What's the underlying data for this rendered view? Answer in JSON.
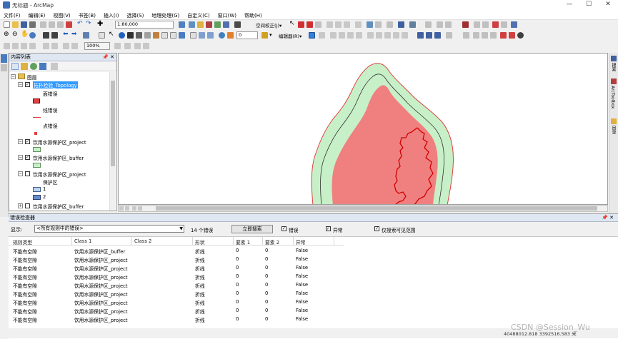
{
  "window": {
    "title": "无标题 - ArcMap",
    "min": "—",
    "max": "☐",
    "close": "✕"
  },
  "menu": [
    "文件(F)",
    "编辑(E)",
    "视图(V)",
    "书签(B)",
    "插入(I)",
    "选择(S)",
    "地理处理(G)",
    "自定义(C)",
    "窗口(W)",
    "帮助(H)"
  ],
  "toolbar": {
    "scale": "1:80,000",
    "spatial_adjust": "空间校正(J)▾",
    "editor": "编辑器(R)▾",
    "zoom_combo": "0",
    "percent": "100%"
  },
  "toc": {
    "title": "内容列表",
    "pin": "📌 ✕",
    "root": "图层",
    "items": [
      {
        "label": "拓扑检验_Topology",
        "checked": true,
        "selected": true
      },
      {
        "label": "面错误"
      },
      {
        "label": "线错误"
      },
      {
        "label": "点错误"
      },
      {
        "label": "饮用水源保护区_project",
        "checked": true
      },
      {
        "label": "饮用水源保护区_buffer",
        "checked": true
      },
      {
        "label": "饮用水源保护区_project",
        "checked": false
      },
      {
        "label": "保护区"
      },
      {
        "label": "1"
      },
      {
        "label": "2"
      },
      {
        "label": "饮用水源保护区_buffer",
        "checked": false
      }
    ]
  },
  "right_tabs": [
    "搜索",
    "ArcToolbox",
    "目录"
  ],
  "error_inspector": {
    "title": "错误检查器",
    "show_label": "显示:",
    "show_value": "<所有规则中的错误>",
    "count": "14 个错误",
    "search_btn": "立即搜索",
    "cb_errors": "错误",
    "cb_exceptions": "异常",
    "cb_visible": "仅搜索可见范围",
    "columns": [
      "规则类型",
      "Class 1",
      "Class 2",
      "形状",
      "要素 1",
      "要素 2",
      "异常"
    ],
    "rows": [
      [
        "不能有空隙",
        "饮用水源保护区_buffer",
        "",
        "折线",
        "0",
        "0",
        "False"
      ],
      [
        "不能有空隙",
        "饮用水源保护区_project",
        "",
        "折线",
        "0",
        "0",
        "False"
      ],
      [
        "不能有空隙",
        "饮用水源保护区_project",
        "",
        "折线",
        "0",
        "0",
        "False"
      ],
      [
        "不能有空隙",
        "饮用水源保护区_project",
        "",
        "折线",
        "0",
        "0",
        "False"
      ],
      [
        "不能有空隙",
        "饮用水源保护区_project",
        "",
        "折线",
        "0",
        "0",
        "False"
      ],
      [
        "不能有空隙",
        "饮用水源保护区_project",
        "",
        "折线",
        "0",
        "0",
        "False"
      ],
      [
        "不能有空隙",
        "饮用水源保护区_project",
        "",
        "折线",
        "0",
        "0",
        "False"
      ],
      [
        "不能有空隙",
        "饮用水源保护区_project",
        "",
        "折线",
        "0",
        "0",
        "False"
      ],
      [
        "不能有空隙",
        "饮用水源保护区_project",
        "",
        "折线",
        "0",
        "0",
        "False"
      ]
    ]
  },
  "status": {
    "coords": "40488012.818  3392516.583 米",
    "watermark": "CSDN @Session_Wu"
  },
  "colors": {
    "buffer_fill": "#c8f0c8",
    "project_fill": "#f08080",
    "error_line": "#d00000",
    "selection": "#3399ff"
  }
}
